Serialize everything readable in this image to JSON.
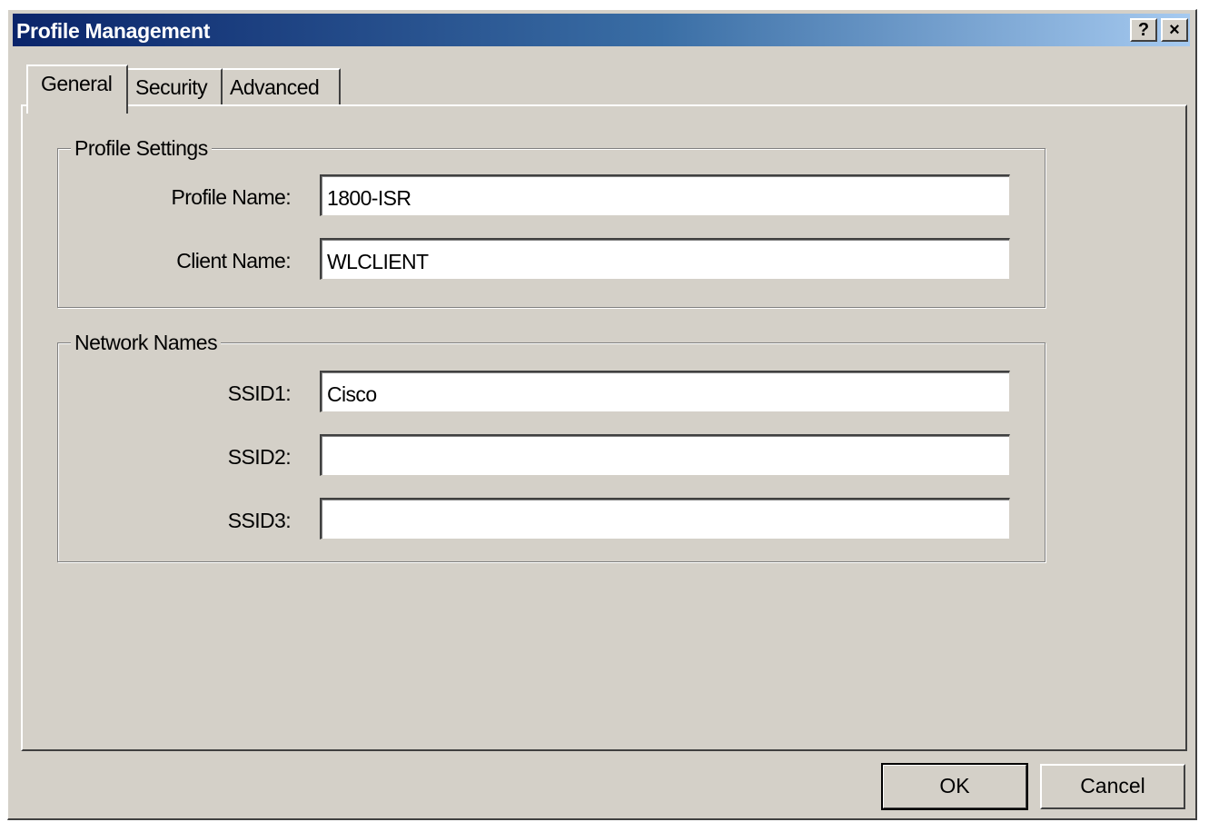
{
  "window": {
    "title": "Profile Management",
    "help_label": "?",
    "close_label": "×"
  },
  "tabs": [
    {
      "label": "General",
      "selected": true
    },
    {
      "label": "Security",
      "selected": false
    },
    {
      "label": "Advanced",
      "selected": false
    }
  ],
  "profile_settings": {
    "legend": "Profile Settings",
    "profile_name_label": "Profile Name:",
    "profile_name_value": "1800-ISR",
    "client_name_label": "Client Name:",
    "client_name_value": "WLCLIENT"
  },
  "network_names": {
    "legend": "Network Names",
    "ssid1_label": "SSID1:",
    "ssid1_value": "Cisco",
    "ssid2_label": "SSID2:",
    "ssid2_value": "",
    "ssid3_label": "SSID3:",
    "ssid3_value": ""
  },
  "buttons": {
    "ok_label": "OK",
    "cancel_label": "Cancel"
  },
  "colors": {
    "dialog_face": "#d4d0c8",
    "titlebar_start": "#0a246a",
    "titlebar_end": "#a6caf0"
  }
}
